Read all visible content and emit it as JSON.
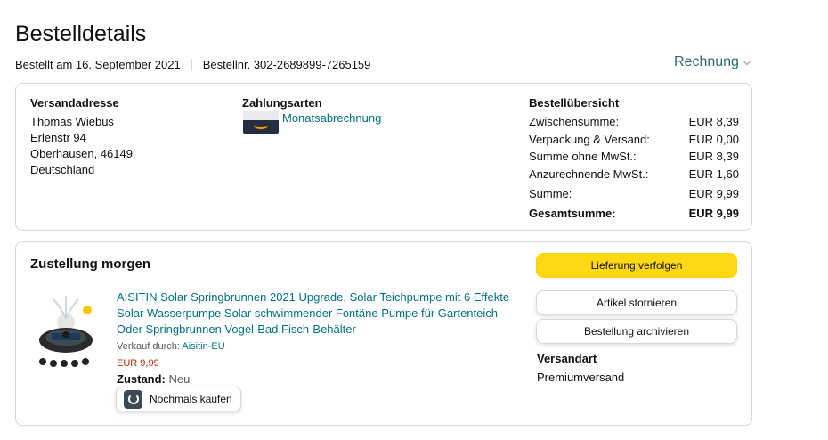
{
  "header": {
    "title": "Bestelldetails",
    "ordered_on": "Bestellt am 16. September 2021",
    "order_number": "Bestellnr. 302-2689899-7265159",
    "invoice_label": "Rechnung"
  },
  "shipping_address": {
    "heading": "Versandadresse",
    "lines": [
      "Thomas Wiebus",
      "Erlenstr 94",
      "Oberhausen, 46149",
      "Deutschland"
    ]
  },
  "payment": {
    "heading": "Zahlungsarten",
    "method": "Monatsabrechnung"
  },
  "summary": {
    "heading": "Bestellübersicht",
    "rows": [
      {
        "label": "Zwischensumme:",
        "value": "EUR 8,39"
      },
      {
        "label": "Verpackung & Versand:",
        "value": "EUR 0,00"
      },
      {
        "label": "Summe ohne MwSt.:",
        "value": "EUR 8,39"
      },
      {
        "label": "Anzurechnende MwSt.:",
        "value": "EUR 1,60"
      },
      {
        "label": "Summe:",
        "value": "EUR 9,99"
      },
      {
        "label": "Gesamtsumme:",
        "value": "EUR 9,99"
      }
    ]
  },
  "delivery": {
    "title": "Zustellung morgen",
    "product_title": "AISITIN Solar Springbrunnen 2021 Upgrade, Solar Teichpumpe mit 6 Effekte Solar Wasserpumpe Solar schwimmender Fontäne Pumpe für Gartenteich Oder Springbrunnen Vogel-Bad Fisch-Behälter",
    "seller_prefix": "Verkauf durch: ",
    "seller_name": "Aisitin-EU",
    "price": "EUR 9,99",
    "condition_label": "Zustand:",
    "condition_value": "Neu",
    "rebuy_label": "Nochmals kaufen",
    "track_label": "Lieferung verfolgen",
    "cancel_label": "Artikel stornieren",
    "archive_label": "Bestellung archivieren",
    "ship_method_heading": "Versandart",
    "ship_method_value": "Premiumversand"
  },
  "colors": {
    "link": "#007185",
    "invoice_link": "#2f6a73",
    "primary_button": "#ffd814",
    "price": "#b12704",
    "border": "#d5d9d9"
  }
}
